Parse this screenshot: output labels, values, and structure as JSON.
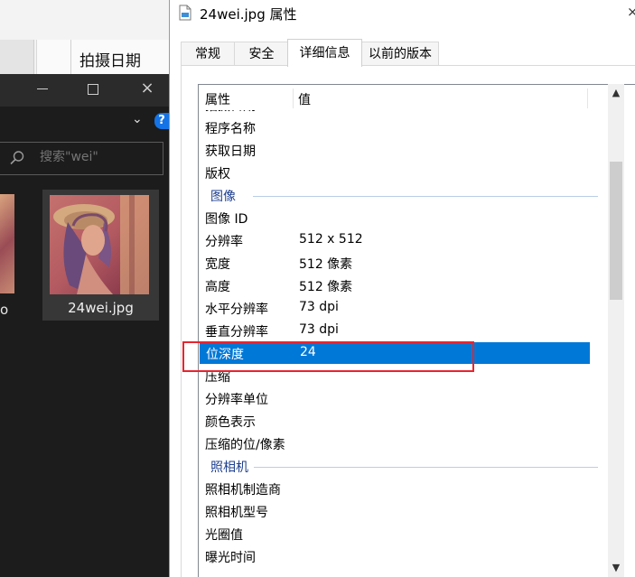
{
  "background_window": {
    "column_header": "拍摄日期",
    "search_placeholder": "搜索\"wei\"",
    "prev_item_label": "o",
    "file_name": "24wei.jpg",
    "window_controls": {
      "minimize": "minimize-icon",
      "maximize": "maximize-icon",
      "close": "×"
    },
    "help_glyph": "?",
    "chevron": "⌄"
  },
  "dialog": {
    "title": "24wei.jpg 属性",
    "close_glyph": "×",
    "tabs": [
      {
        "label": "常规",
        "active": false
      },
      {
        "label": "安全",
        "active": false
      },
      {
        "label": "详细信息",
        "active": true
      },
      {
        "label": "以前的版本",
        "active": false
      }
    ],
    "columns": {
      "name": "属性",
      "value": "值"
    },
    "rows": [
      {
        "kind": "row",
        "name": "拍摄日期",
        "value": ""
      },
      {
        "kind": "row",
        "name": "程序名称",
        "value": ""
      },
      {
        "kind": "row",
        "name": "获取日期",
        "value": ""
      },
      {
        "kind": "row",
        "name": "版权",
        "value": ""
      },
      {
        "kind": "group",
        "name": "图像"
      },
      {
        "kind": "row",
        "name": "图像 ID",
        "value": ""
      },
      {
        "kind": "row",
        "name": "分辨率",
        "value": "512 x 512"
      },
      {
        "kind": "row",
        "name": "宽度",
        "value": "512 像素"
      },
      {
        "kind": "row",
        "name": "高度",
        "value": "512 像素"
      },
      {
        "kind": "row",
        "name": "水平分辨率",
        "value": "73 dpi"
      },
      {
        "kind": "row",
        "name": "垂直分辨率",
        "value": "73 dpi"
      },
      {
        "kind": "row",
        "name": "位深度",
        "value": "24",
        "selected": true
      },
      {
        "kind": "row",
        "name": "压缩",
        "value": ""
      },
      {
        "kind": "row",
        "name": "分辨率单位",
        "value": ""
      },
      {
        "kind": "row",
        "name": "颜色表示",
        "value": ""
      },
      {
        "kind": "row",
        "name": "压缩的位/像素",
        "value": ""
      },
      {
        "kind": "group",
        "name": "照相机"
      },
      {
        "kind": "row",
        "name": "照相机制造商",
        "value": ""
      },
      {
        "kind": "row",
        "name": "照相机型号",
        "value": ""
      },
      {
        "kind": "row",
        "name": "光圈值",
        "value": ""
      },
      {
        "kind": "row",
        "name": "曝光时间",
        "value": ""
      }
    ],
    "scroll_up": "▲",
    "scroll_down": "▼"
  },
  "colors": {
    "selection": "#0078d7",
    "annotation_box": "#e8242f",
    "group_header": "#1e3f8f",
    "explorer_bg": "#1c1c1c"
  }
}
